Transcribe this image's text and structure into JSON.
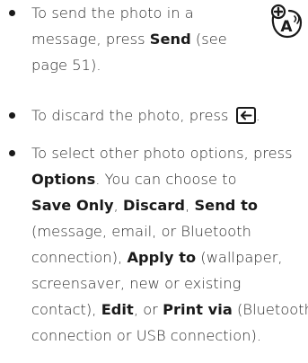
{
  "bullets": [
    {
      "lines": [
        [
          "To send the photo in a"
        ],
        [
          "message, press ",
          {
            "k": "Send"
          },
          " (see"
        ],
        [
          "page 51)."
        ]
      ]
    },
    {
      "lines": [
        [
          "To discard the photo, press ",
          {
            "icon": "back-key-icon"
          },
          "."
        ]
      ]
    },
    {
      "lines": [
        [
          "To select other photo options, press"
        ],
        [
          {
            "k": "Options"
          },
          ". You can choose to"
        ],
        [
          {
            "k": "Save Only"
          },
          ", ",
          {
            "k": "Discard"
          },
          ", ",
          {
            "k": "Send to"
          }
        ],
        [
          "(message, email, or Bluetooth"
        ],
        [
          "connection), ",
          {
            "k": "Apply to"
          },
          " (wallpaper,"
        ],
        [
          "screensaver, new or existing"
        ],
        [
          "contact), ",
          {
            "k": "Edit"
          },
          ", or ",
          {
            "k": "Print via"
          },
          " (Bluetooth"
        ],
        [
          "connection or USB connection)."
        ]
      ]
    }
  ],
  "feature_icon": {
    "name": "network-feature-icon",
    "letter": "A"
  }
}
